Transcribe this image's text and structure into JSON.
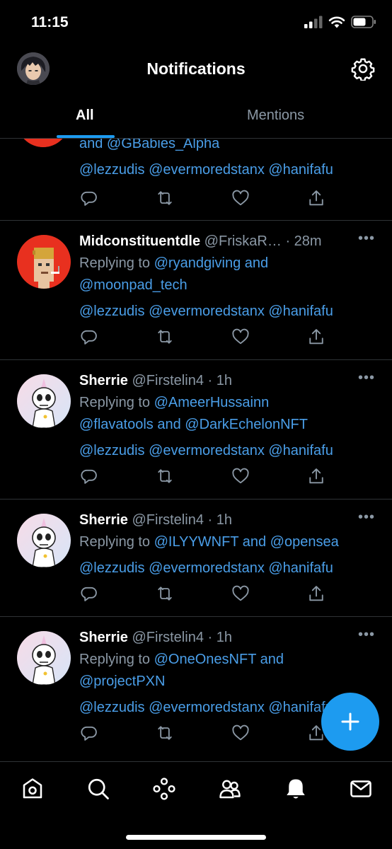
{
  "status": {
    "time": "11:15"
  },
  "header": {
    "title": "Notifications"
  },
  "tabs": [
    {
      "label": "All"
    },
    {
      "label": "Mentions"
    }
  ],
  "partial": {
    "line1": "and @GBabies_Alpha",
    "mentions": "@lezzudis @evermoredstanx @hanifafu"
  },
  "notifications": [
    {
      "name": "Midconstituentdle",
      "handle": "@FriskaR…",
      "time": "· 28m",
      "replying_prefix": "Replying to",
      "replying_line1": "@ryandgiving and",
      "replying_line2": "@moonpad_tech",
      "mentions": "@lezzudis @evermoredstanx @hanifafu"
    },
    {
      "name": "Sherrie",
      "handle": "@Firstelin4",
      "time": "· 1h",
      "replying_prefix": "Replying to",
      "replying_line1": "@AmeerHussainn",
      "replying_line2": "@flavatools and @DarkEchelonNFT",
      "mentions": "@lezzudis @evermoredstanx @hanifafu"
    },
    {
      "name": "Sherrie",
      "handle": "@Firstelin4",
      "time": "· 1h",
      "replying_prefix": "Replying to",
      "replying_line1": "@ILYYWNFT and @opensea",
      "mentions": "@lezzudis @evermoredstanx @hanifafu"
    },
    {
      "name": "Sherrie",
      "handle": "@Firstelin4",
      "time": "· 1h",
      "replying_prefix": "Replying to",
      "replying_line1": "@OneOnesNFT and",
      "replying_line2": "@projectPXN",
      "mentions": "@lezzudis @evermoredstanx @hanifafu"
    }
  ],
  "icons": {
    "more": "more-icon",
    "reply": "reply-icon",
    "retweet": "retweet-icon",
    "like": "heart-icon",
    "share": "share-icon",
    "compose": "plus-icon"
  },
  "colors": {
    "accent": "#1d9bf0",
    "link": "#4a9ee8",
    "muted": "#8b98a5",
    "background": "#000000"
  }
}
